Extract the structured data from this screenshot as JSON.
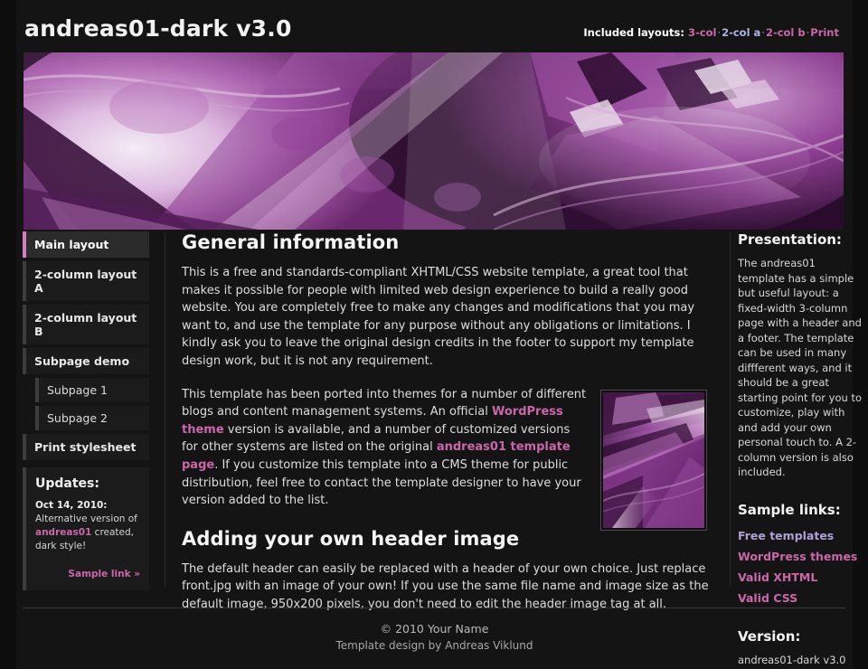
{
  "header": {
    "site_title": "andreas01-dark v3.0",
    "layouts_label": "Included layouts:",
    "layout_links": [
      {
        "label": "3-col",
        "visited": false
      },
      {
        "label": "2-col a",
        "visited": true
      },
      {
        "label": "2-col b",
        "visited": false
      },
      {
        "label": "Print",
        "visited": false
      }
    ],
    "separator": "·"
  },
  "banner": {
    "alt": "abstract purple fractal header image",
    "size_note": "950x200"
  },
  "sidebar_left": {
    "nav": [
      {
        "label": "Main layout",
        "active": true,
        "sub": false
      },
      {
        "label": "2-column layout A",
        "active": false,
        "sub": false
      },
      {
        "label": "2-column layout B",
        "active": false,
        "sub": false
      },
      {
        "label": "Subpage demo",
        "active": false,
        "sub": false
      },
      {
        "label": "Subpage 1",
        "active": false,
        "sub": true
      },
      {
        "label": "Subpage 2",
        "active": false,
        "sub": true
      },
      {
        "label": "Print stylesheet",
        "active": false,
        "sub": false
      }
    ],
    "updates": {
      "title": "Updates:",
      "date": "Oct 14, 2010:",
      "text_before": "Alternative version of ",
      "link": "andreas01",
      "text_after": " created, dark style!",
      "more_link": "Sample link »"
    }
  },
  "content": {
    "heading_1": "General information",
    "paragraph_1": "This is a free and standards-compliant XHTML/CSS website template, a great tool that makes it possible for people with limited web design experience to build a really good website. You are completely free to make any changes and modifications that you may want to, and use the template for any purpose without any obligations or limitations. I kindly ask you to leave the original design credits in the footer to support my template design work, but it is not any requirement.",
    "paragraph_2": {
      "part_1": "This template has been ported into themes for a number of different blogs and content management systems. An official ",
      "link_1": "WordPress theme",
      "part_2": " version is available, and a number of customized versions for other systems are listed on the original ",
      "link_2": "andreas01 template page",
      "part_3": ". If you customize this template into a CMS theme for public distribution, feel free to contact the template designer to have your version added to the list."
    },
    "heading_2": "Adding your own header image",
    "paragraph_3": "The default header can easily be replaced with a header of your own choice. Just replace front.jpg with an image of your own! If you use the same file name and image size as the default image, 950x200 pixels, you don't need to edit the header image tag at all."
  },
  "sidebar_right": {
    "presentation_title": "Presentation:",
    "presentation_text": "The andreas01 template has a simple but useful layout: a fixed-width 3-column page with a header and a footer. The template can be used in many diffferent ways, and it should be a great starting point for you to customize, play with and add your own personal touch to. A 2-column version is also included.",
    "sample_links_title": "Sample links:",
    "sample_links": [
      {
        "label": "Free templates",
        "visited": true
      },
      {
        "label": "WordPress themes",
        "visited": false
      },
      {
        "label": "Valid XHTML",
        "visited": false
      },
      {
        "label": "Valid CSS",
        "visited": false
      }
    ],
    "version_title": "Version:",
    "version_value": "andreas01-dark v3.0"
  },
  "footer": {
    "line_1": "© 2010 Your Name",
    "line_2": "Template design by Andreas Viklund"
  },
  "colors": {
    "page_bg": "#0d0d0d",
    "container_bg": "#141414",
    "link_pink": "#cc66aa",
    "link_visited": "#b0a0d8",
    "accent_border": "#d47ec0",
    "text": "#dedede"
  }
}
